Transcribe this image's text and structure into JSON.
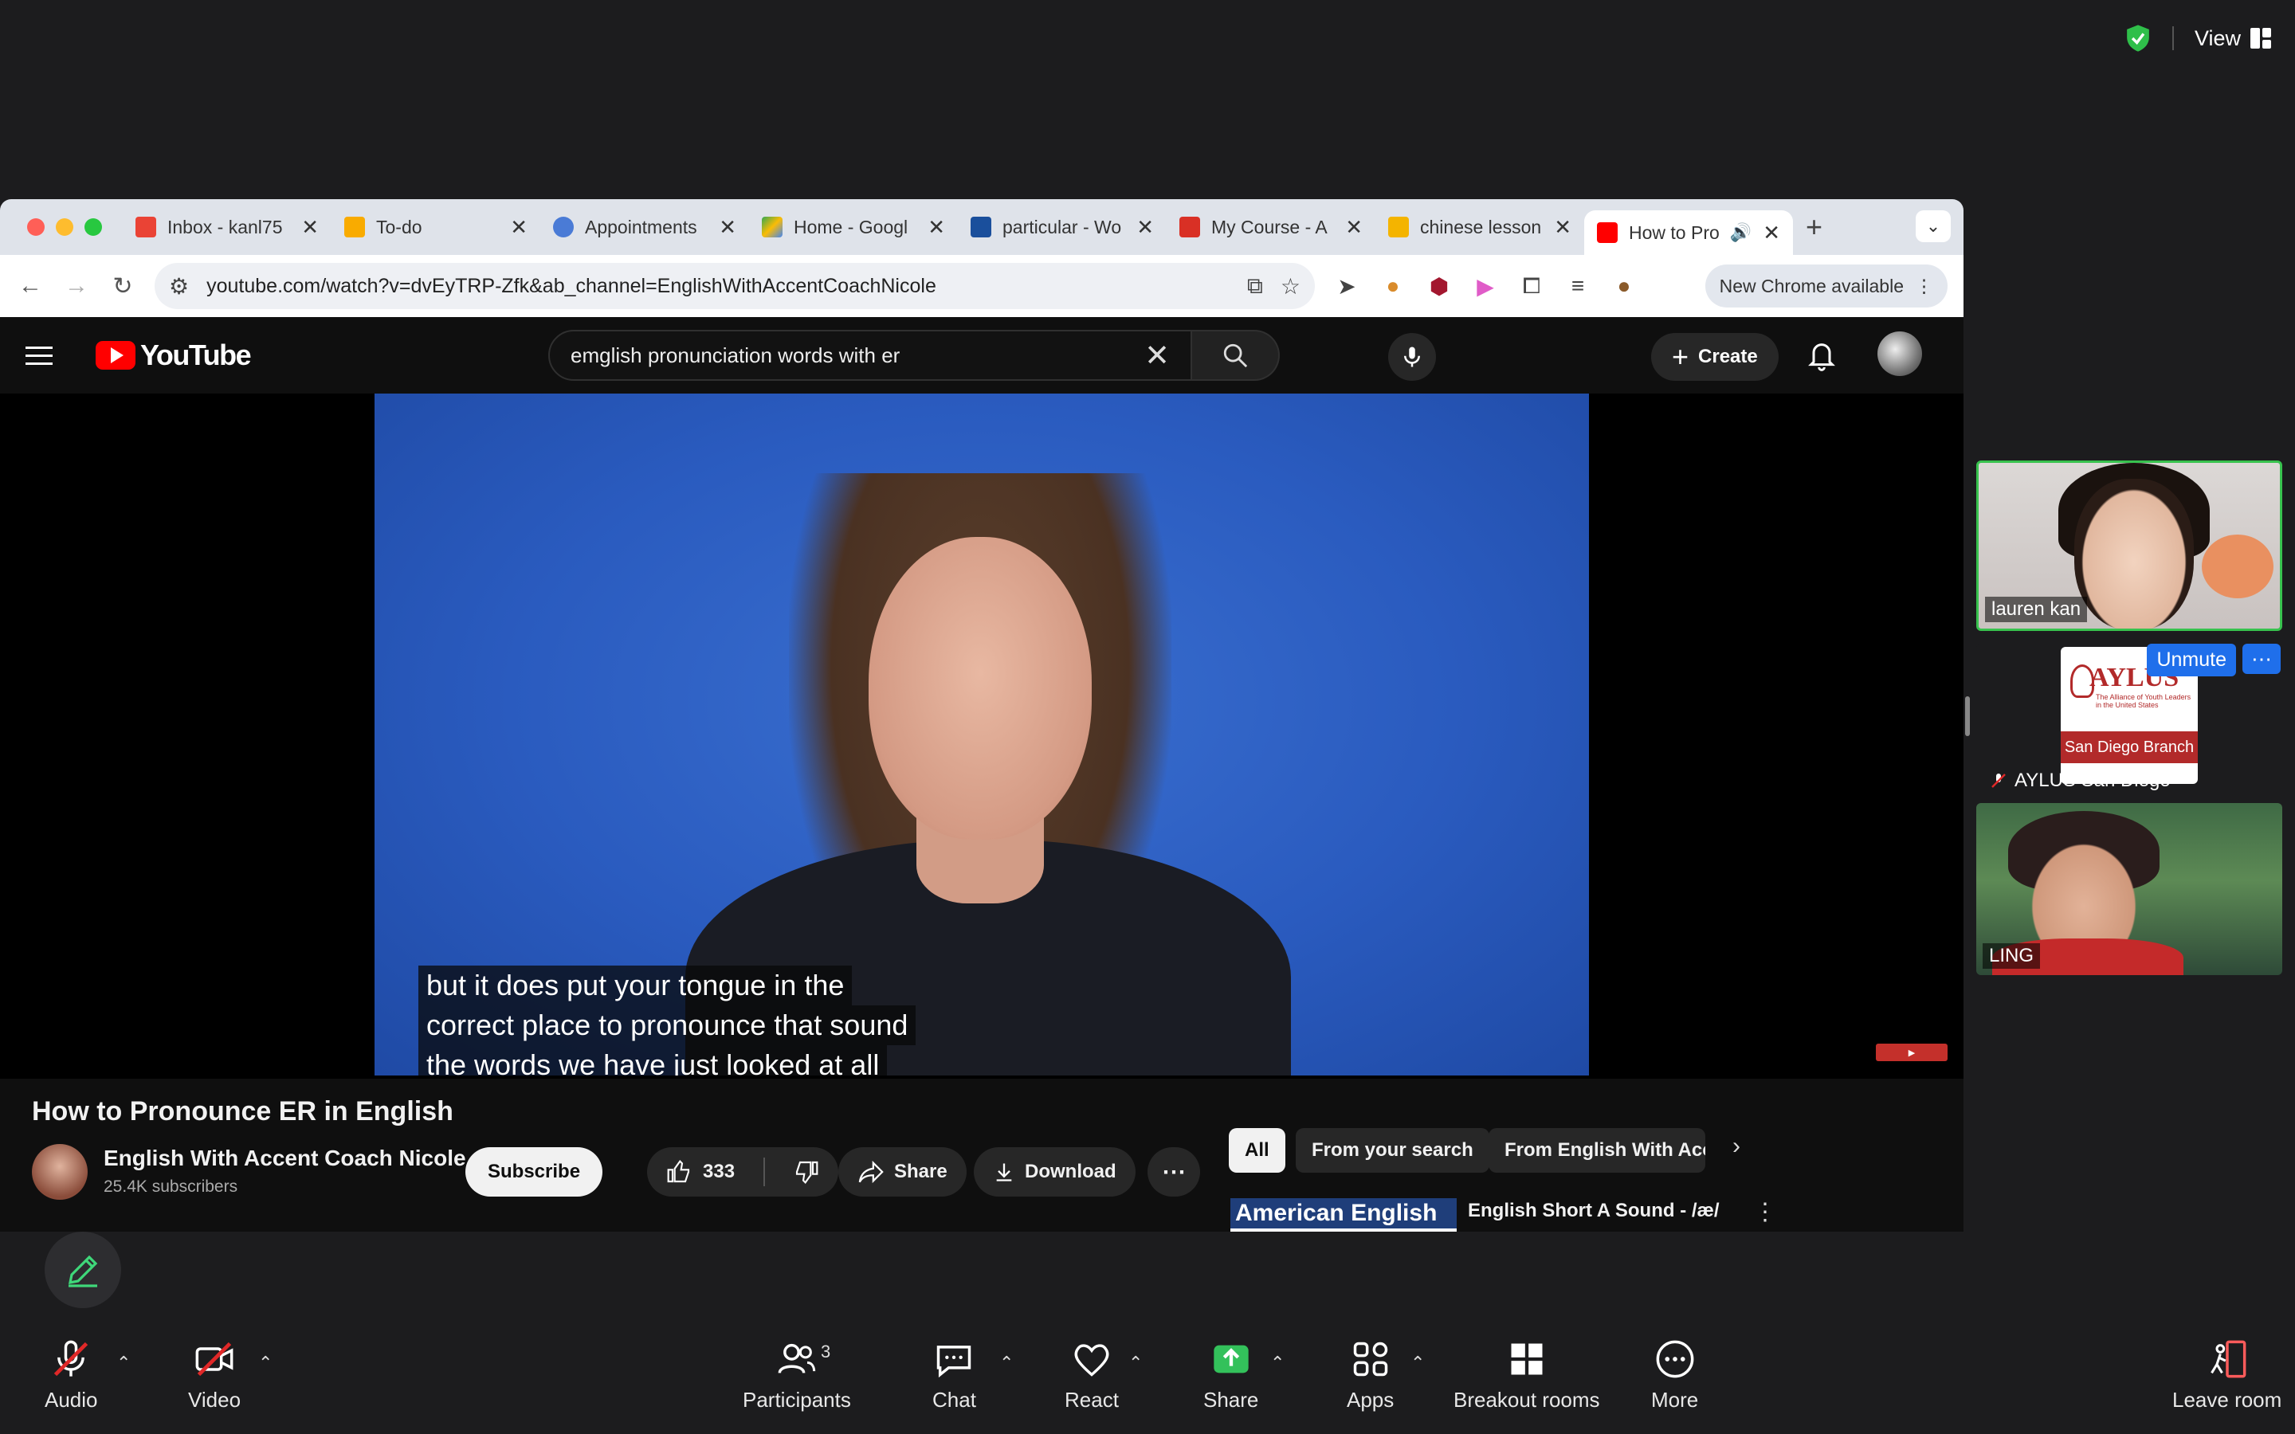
{
  "zoom": {
    "view_label": "View"
  },
  "browser": {
    "tabs": [
      {
        "title": "Inbox - kanl75",
        "favicon": "gmail-icon",
        "color": "#ea4335"
      },
      {
        "title": "To-do",
        "favicon": "todo-icon",
        "color": "#f9ab00"
      },
      {
        "title": "Appointments",
        "favicon": "appointments-icon",
        "color": "#4a7bd6"
      },
      {
        "title": "Home - Googl",
        "favicon": "google-drive-icon",
        "color": "#34a853"
      },
      {
        "title": "particular - Wo",
        "favicon": "wordreference-icon",
        "color": "#1a4f9c"
      },
      {
        "title": "My Course - A",
        "favicon": "course-icon",
        "color": "#d93025"
      },
      {
        "title": "chinese lesson",
        "favicon": "slides-icon",
        "color": "#f4b400"
      },
      {
        "title": "How to Pro",
        "favicon": "youtube-icon",
        "color": "#ff0000",
        "active": true
      }
    ],
    "url": "youtube.com/watch?v=dvEyTRP-Zfk&ab_channel=EnglishWithAccentCoachNicole",
    "new_chrome_label": "New Chrome available"
  },
  "youtube": {
    "logo_text": "YouTube",
    "search_query": "emglish pronunciation words with er",
    "create_label": "Create",
    "captions": [
      "but it does put your tongue in the",
      "correct place to pronounce that sound",
      "the words we have just looked at all"
    ],
    "video_title": "How to Pronounce ER in English",
    "channel_name": "English With Accent Coach Nicole",
    "subscribers": "25.4K subscribers",
    "subscribe_label": "Subscribe",
    "like_count": "333",
    "share_label": "Share",
    "download_label": "Download",
    "chips": [
      "All",
      "From your search",
      "From English With Acce"
    ],
    "recommended": {
      "thumb_text": "American English",
      "title": "English Short A Sound - /æ/"
    }
  },
  "participants": {
    "tiles": [
      {
        "name": "lauren kan"
      },
      {
        "name": "AYLUS San Diego",
        "card_title": "AYLUS",
        "card_tagline": "The Alliance of Youth Leaders in the United States",
        "card_branch": "San Diego Branch",
        "unmute_label": "Unmute"
      },
      {
        "name": "LING"
      }
    ]
  },
  "toolbar": {
    "audio": "Audio",
    "video": "Video",
    "participants": "Participants",
    "participant_count": "3",
    "chat": "Chat",
    "react": "React",
    "share": "Share",
    "apps": "Apps",
    "breakout": "Breakout rooms",
    "more": "More",
    "leave": "Leave room"
  }
}
